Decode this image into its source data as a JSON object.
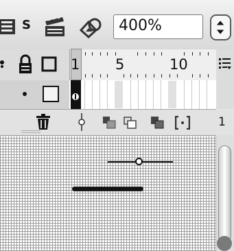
{
  "toolbar": {
    "scene_label": "S",
    "zoom_value": "400%"
  },
  "ruler": {
    "marks": [
      "1",
      "5",
      "10"
    ]
  },
  "timeline_controls": {
    "trailing_number": "1"
  },
  "colors": {
    "playhead": "#111111",
    "toolbar_bg": "#e0e0e0",
    "grid": "#9a9a9a"
  },
  "icons": [
    "edit-scene-icon",
    "edit-symbol-icon",
    "zoom-icon",
    "lock-icon",
    "outline-icon",
    "menu-icon",
    "trash-icon",
    "center-frame-icon",
    "onion-skin-icon",
    "onion-skin-outline-icon",
    "edit-multiple-frames-icon",
    "modify-markers-icon"
  ]
}
